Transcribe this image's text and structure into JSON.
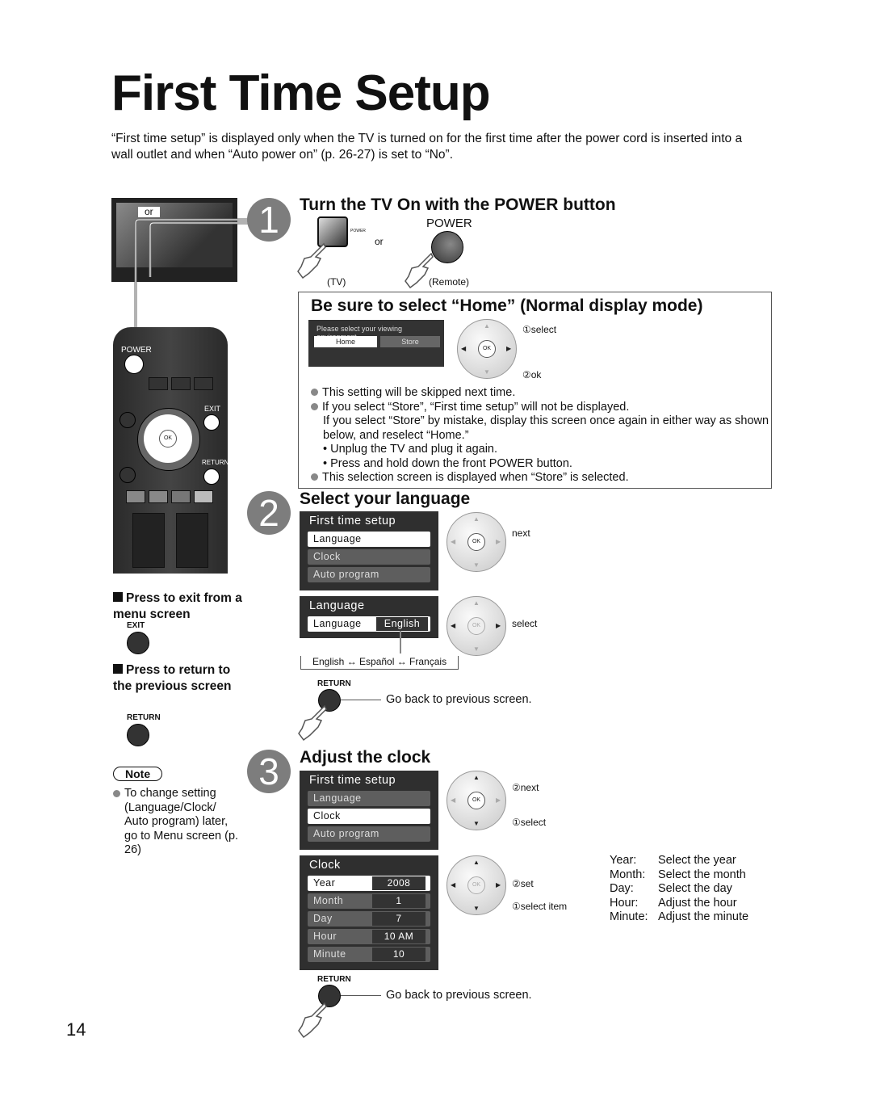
{
  "page": {
    "title": "First Time Setup",
    "intro": "“First time setup” is displayed only when the TV is turned on for the first time after the power cord is inserted into a wall outlet and when “Auto power on” (p. 26-27) is set to “No”.",
    "page_number": "14"
  },
  "tv_illustration": {
    "or_label": "or"
  },
  "remote": {
    "power_label": "POWER",
    "exit_label": "EXIT",
    "return_label": "RETURN",
    "ok_label": "OK"
  },
  "step1": {
    "number": "1",
    "heading": "Turn the TV On with the POWER button",
    "tv_power_small": "POWER",
    "or": "or",
    "remote_power_label": "POWER",
    "tv_caption": "(TV)",
    "remote_caption": "(Remote)",
    "home_box": {
      "heading": "Be sure to select “Home” (Normal display mode)",
      "screen_prompt": "Please select your viewing environment.",
      "option_home": "Home",
      "option_store": "Store",
      "callout_select": "①select",
      "callout_ok": "②ok",
      "bullets": [
        "This setting will be skipped next time.",
        "If you select “Store”, “First time setup” will not be displayed.",
        "This selection screen is displayed when “Store” is selected."
      ],
      "store_note": "If you select “Store” by mistake, display this screen once again in either way as shown below, and reselect “Home.”",
      "sub_bullets": [
        "• Unplug the TV and plug it again.",
        "• Press and hold down the front POWER button."
      ]
    }
  },
  "step2": {
    "number": "2",
    "heading": "Select your language",
    "menu": {
      "title": "First time setup",
      "items": [
        "Language",
        "Clock",
        "Auto program"
      ],
      "selected": "Language"
    },
    "callout_next": "next",
    "language_panel": {
      "title": "Language",
      "row_label": "Language",
      "value": "English"
    },
    "callout_select": "select",
    "cycle": "English ↔ Español ↔ Français",
    "return_label": "RETURN",
    "return_caption": "Go back to previous screen."
  },
  "sidebar": {
    "exit_heading": "Press to exit from a menu screen",
    "exit_label": "EXIT",
    "return_heading": "Press to return to the previous screen",
    "return_label": "RETURN",
    "note_label": "Note",
    "note_text": "To change setting (Language/Clock/ Auto program) later, go to Menu screen (p. 26)"
  },
  "step3": {
    "number": "3",
    "heading": "Adjust the clock",
    "menu": {
      "title": "First time setup",
      "items": [
        "Language",
        "Clock",
        "Auto program"
      ],
      "selected": "Clock"
    },
    "callout_next": "②next",
    "callout_select": "①select",
    "clock_panel": {
      "title": "Clock",
      "rows": [
        {
          "label": "Year",
          "value": "2008"
        },
        {
          "label": "Month",
          "value": "1"
        },
        {
          "label": "Day",
          "value": "7"
        },
        {
          "label": "Hour",
          "value": "10 AM"
        },
        {
          "label": "Minute",
          "value": "10"
        }
      ]
    },
    "callout_set": "②set",
    "callout_select_item": "①select item",
    "legend": [
      {
        "key": "Year:",
        "desc": "Select the year"
      },
      {
        "key": "Month:",
        "desc": "Select the month"
      },
      {
        "key": "Day:",
        "desc": "Select the day"
      },
      {
        "key": "Hour:",
        "desc": "Adjust the hour"
      },
      {
        "key": "Minute:",
        "desc": "Adjust the minute"
      }
    ],
    "return_label": "RETURN",
    "return_caption": "Go back to previous screen."
  }
}
